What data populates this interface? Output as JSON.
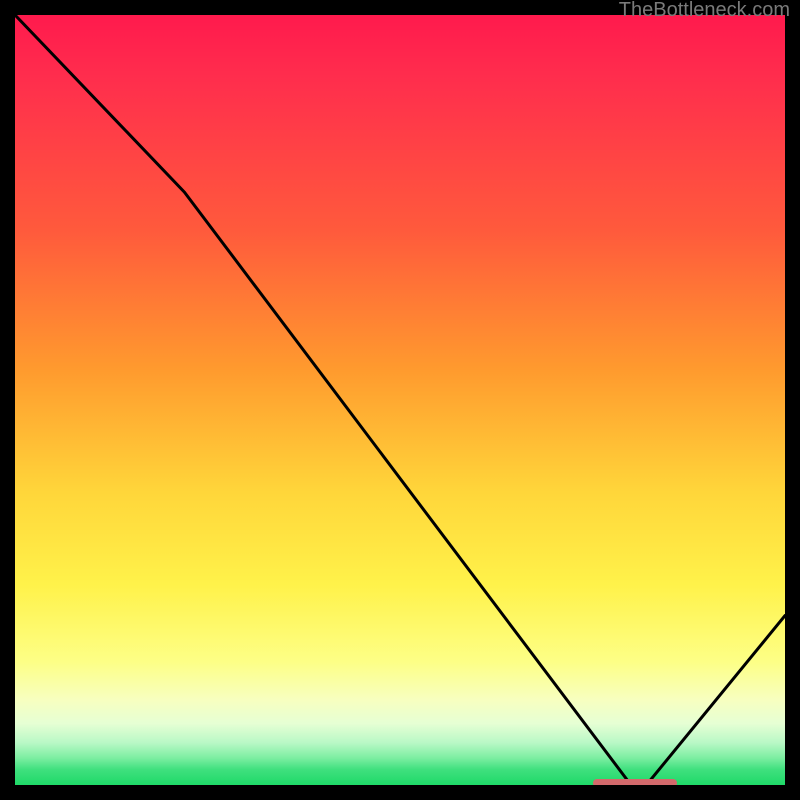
{
  "watermark": "TheBottleneck.com",
  "chart_data": {
    "type": "line",
    "title": "",
    "xlabel": "",
    "ylabel": "",
    "xlim": [
      0,
      100
    ],
    "ylim": [
      0,
      100
    ],
    "grid": false,
    "note": "Axis values are estimated from pixel positions; the image has no numeric axis labels.",
    "series": [
      {
        "name": "bottleneck-curve",
        "x": [
          0,
          22,
          80,
          82,
          100
        ],
        "y": [
          100,
          77,
          0,
          0,
          22
        ]
      }
    ],
    "annotations": [
      {
        "name": "optimal-marker",
        "x_start": 75,
        "x_end": 86,
        "y": 0,
        "color": "#d2696b"
      }
    ],
    "background_gradient": {
      "stops": [
        {
          "pos": 0,
          "color": "#ff1a4d"
        },
        {
          "pos": 0.28,
          "color": "#ff5a3c"
        },
        {
          "pos": 0.62,
          "color": "#ffd63a"
        },
        {
          "pos": 0.84,
          "color": "#fdff86"
        },
        {
          "pos": 0.96,
          "color": "#7ceea1"
        },
        {
          "pos": 1.0,
          "color": "#1fd968"
        }
      ]
    }
  },
  "colors": {
    "curve": "#000000",
    "marker": "#d2696b",
    "frame_bg": "#000000",
    "watermark": "#7a7a7a"
  }
}
